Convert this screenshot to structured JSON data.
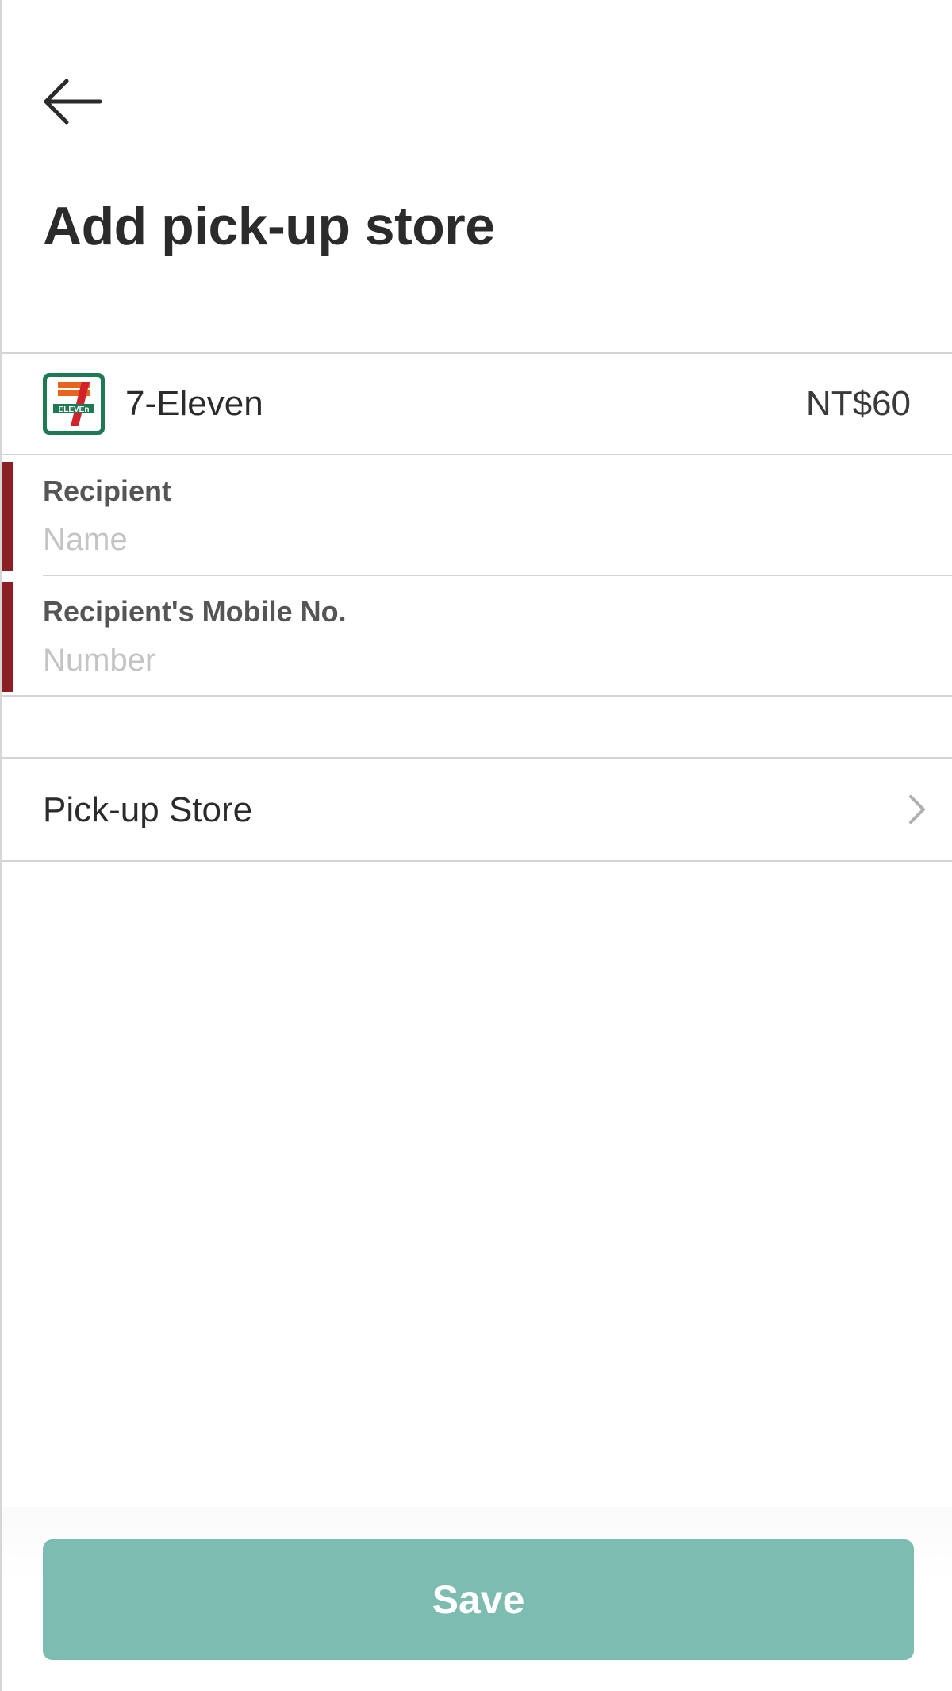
{
  "header": {
    "back_icon": "arrow-left-icon",
    "title": "Add pick-up store"
  },
  "carrier": {
    "logo_icon": "seven-eleven-logo-icon",
    "name": "7-Eleven",
    "price": "NT$60"
  },
  "form": {
    "recipient": {
      "label": "Recipient",
      "placeholder": "Name",
      "value": ""
    },
    "mobile": {
      "label": "Recipient's Mobile No.",
      "placeholder": "Number",
      "value": ""
    },
    "error_color": "#8b1f24"
  },
  "pickup_store": {
    "label": "Pick-up Store",
    "chevron_icon": "chevron-right-icon"
  },
  "footer": {
    "save_label": "Save",
    "save_color": "#7dbcb0"
  }
}
